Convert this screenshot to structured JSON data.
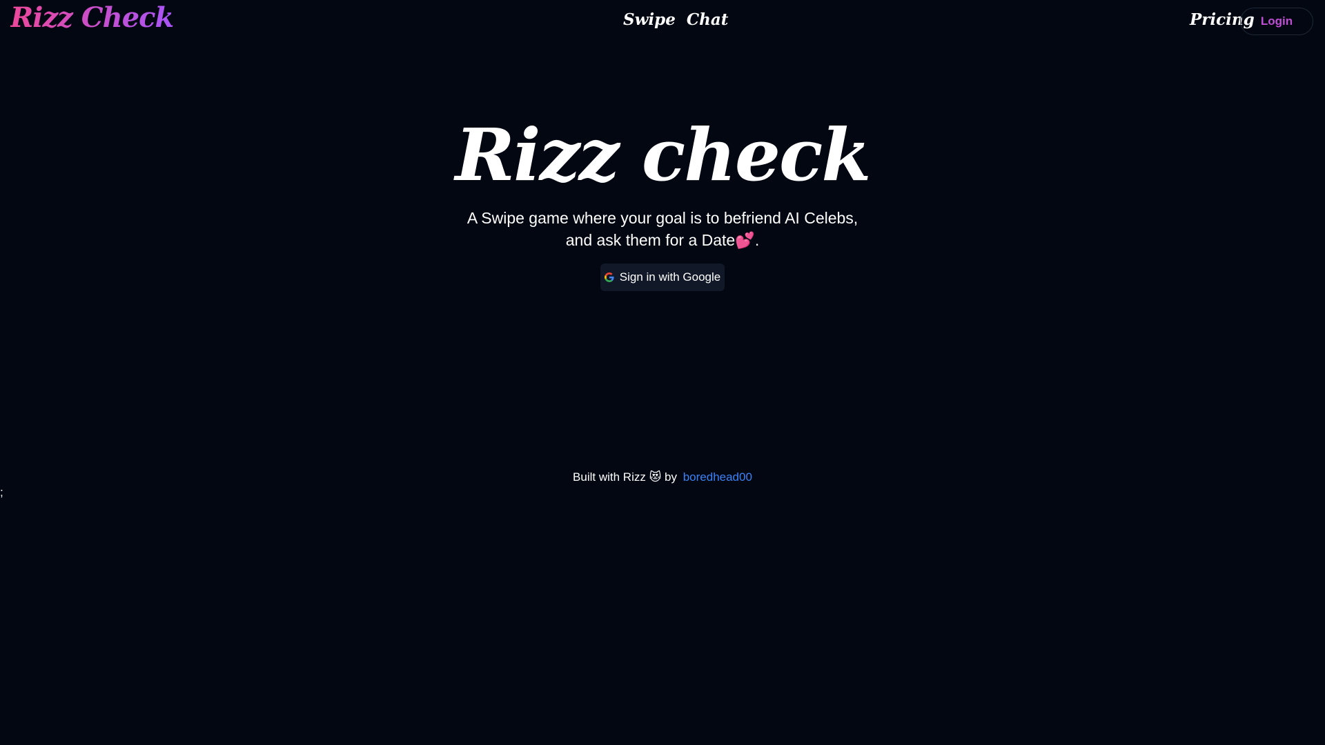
{
  "navbar": {
    "brand": "Rizz Check",
    "links": [
      "Swipe",
      "Chat"
    ],
    "pricing": "Pricing",
    "login": "Login"
  },
  "hero": {
    "title": "Rizz check",
    "subtitle_line1": "A Swipe game where your goal is to befriend AI Celebs,",
    "subtitle_line2": "and ask them for a Date💕.",
    "google_button": "Sign in with Google"
  },
  "footer": {
    "text": "Built with Rizz 😻 by",
    "author": "boredhead00"
  },
  "stray_text": ";",
  "colors": {
    "background": "#030712",
    "brand_gradient_start": "#ec4899",
    "brand_gradient_end": "#a855f7",
    "login_text": "#c04fd6",
    "link": "#3b82f6"
  },
  "icons": {
    "google": "google-g-icon"
  }
}
